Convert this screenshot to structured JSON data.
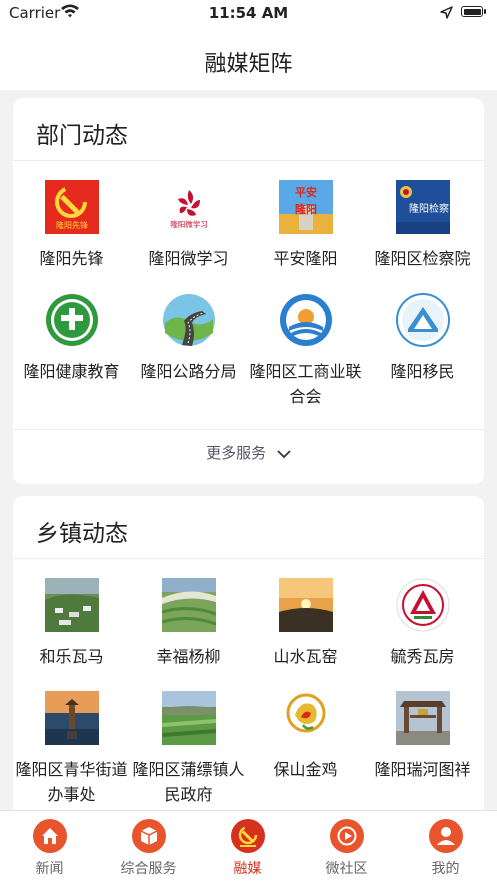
{
  "status_bar": {
    "carrier": "Carrier",
    "time": "11:54 AM"
  },
  "nav": {
    "title": "融媒矩阵"
  },
  "departments": {
    "title": "部门动态",
    "items": [
      {
        "label": "隆阳先锋",
        "icon": "party-emblem-icon"
      },
      {
        "label": "隆阳微学习",
        "icon": "bauhinia-logo-icon"
      },
      {
        "label": "平安隆阳",
        "icon": "police-badge-icon"
      },
      {
        "label": "隆阳区检察院",
        "icon": "procuratorate-emblem-icon"
      },
      {
        "label": "隆阳健康教育",
        "icon": "health-education-logo-icon"
      },
      {
        "label": "隆阳公路分局",
        "icon": "road-logo-icon"
      },
      {
        "label": "隆阳区工商业联合会",
        "icon": "federation-logo-icon"
      },
      {
        "label": "隆阳移民",
        "icon": "migration-logo-icon"
      }
    ],
    "more_label": "更多服务"
  },
  "towns": {
    "title": "乡镇动态",
    "items": [
      {
        "label": "和乐瓦马",
        "icon": "village-photo-icon"
      },
      {
        "label": "幸福杨柳",
        "icon": "terraces-photo-icon"
      },
      {
        "label": "山水瓦窑",
        "icon": "sunset-photo-icon"
      },
      {
        "label": "毓秀瓦房",
        "icon": "town-emblem-icon"
      },
      {
        "label": "隆阳区青华街道办事处",
        "icon": "pagoda-photo-icon"
      },
      {
        "label": "隆阳区蒲缥镇人民政府",
        "icon": "farmland-photo-icon"
      },
      {
        "label": "保山金鸡",
        "icon": "golden-rooster-logo-icon"
      },
      {
        "label": "隆阳瑞河图祥",
        "icon": "archway-photo-icon"
      }
    ]
  },
  "tabs": [
    {
      "label": "新闻",
      "icon": "home-icon",
      "active": false
    },
    {
      "label": "综合服务",
      "icon": "cube-icon",
      "active": false
    },
    {
      "label": "融媒",
      "icon": "party-emblem-icon",
      "active": true
    },
    {
      "label": "微社区",
      "icon": "play-icon",
      "active": false
    },
    {
      "label": "我的",
      "icon": "user-icon",
      "active": false
    }
  ],
  "colors": {
    "accent": "#d6301f",
    "background": "#f2f2f2",
    "tab_icon": "#e8542c"
  }
}
